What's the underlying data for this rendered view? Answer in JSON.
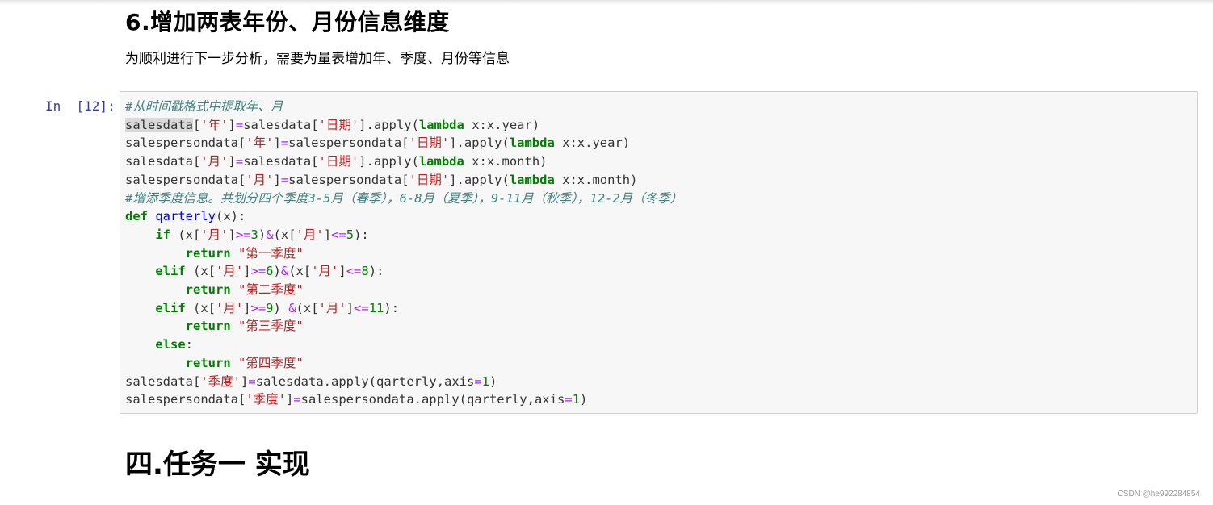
{
  "section": {
    "heading": "6.增加两表年份、月份信息维度",
    "description": "为顺利进行下一步分析，需要为量表增加年、季度、月份等信息"
  },
  "cell": {
    "prompt": "In  [12]:",
    "lines": [
      [
        {
          "t": "#从时间戳格式中提取年、月",
          "c": "cm"
        }
      ],
      [
        {
          "t": "salesdata",
          "c": "hl"
        },
        {
          "t": "["
        },
        {
          "t": "'年'",
          "c": "st"
        },
        {
          "t": "]"
        },
        {
          "t": "=",
          "c": "op"
        },
        {
          "t": "salesdata["
        },
        {
          "t": "'日期'",
          "c": "st"
        },
        {
          "t": "].apply("
        },
        {
          "t": "lambda",
          "c": "kw"
        },
        {
          "t": " x:x.year)"
        }
      ],
      [
        {
          "t": "salespersondata["
        },
        {
          "t": "'年'",
          "c": "st"
        },
        {
          "t": "]"
        },
        {
          "t": "=",
          "c": "op"
        },
        {
          "t": "salespersondata["
        },
        {
          "t": "'日期'",
          "c": "st"
        },
        {
          "t": "].apply("
        },
        {
          "t": "lambda",
          "c": "kw"
        },
        {
          "t": " x:x.year)"
        }
      ],
      [
        {
          "t": "salesdata["
        },
        {
          "t": "'月'",
          "c": "st"
        },
        {
          "t": "]"
        },
        {
          "t": "=",
          "c": "op"
        },
        {
          "t": "salesdata["
        },
        {
          "t": "'日期'",
          "c": "st"
        },
        {
          "t": "].apply("
        },
        {
          "t": "lambda",
          "c": "kw"
        },
        {
          "t": " x:x.month)"
        }
      ],
      [
        {
          "t": "salespersondata["
        },
        {
          "t": "'月'",
          "c": "st"
        },
        {
          "t": "]"
        },
        {
          "t": "=",
          "c": "op"
        },
        {
          "t": "salespersondata["
        },
        {
          "t": "'日期'",
          "c": "st"
        },
        {
          "t": "].apply("
        },
        {
          "t": "lambda",
          "c": "kw"
        },
        {
          "t": " x:x.month)"
        }
      ],
      [
        {
          "t": "#增添季度信息。共划分四个季度3-5月（春季），6-8月（夏季），9-11月（秋季），12-2月（冬季）",
          "c": "cm"
        }
      ],
      [
        {
          "t": "def",
          "c": "kw"
        },
        {
          "t": " "
        },
        {
          "t": "qarterly",
          "c": "fn"
        },
        {
          "t": "(x):"
        }
      ],
      [
        {
          "t": "    "
        },
        {
          "t": "if",
          "c": "kw"
        },
        {
          "t": " (x["
        },
        {
          "t": "'月'",
          "c": "st"
        },
        {
          "t": "]"
        },
        {
          "t": ">=",
          "c": "op"
        },
        {
          "t": "3",
          "c": "nm"
        },
        {
          "t": ")"
        },
        {
          "t": "&",
          "c": "op"
        },
        {
          "t": "(x["
        },
        {
          "t": "'月'",
          "c": "st"
        },
        {
          "t": "]"
        },
        {
          "t": "<=",
          "c": "op"
        },
        {
          "t": "5",
          "c": "nm"
        },
        {
          "t": "):"
        }
      ],
      [
        {
          "t": "        "
        },
        {
          "t": "return",
          "c": "kw"
        },
        {
          "t": " "
        },
        {
          "t": "\"第一季度\"",
          "c": "st"
        }
      ],
      [
        {
          "t": "    "
        },
        {
          "t": "elif",
          "c": "kw"
        },
        {
          "t": " (x["
        },
        {
          "t": "'月'",
          "c": "st"
        },
        {
          "t": "]"
        },
        {
          "t": ">=",
          "c": "op"
        },
        {
          "t": "6",
          "c": "nm"
        },
        {
          "t": ")"
        },
        {
          "t": "&",
          "c": "op"
        },
        {
          "t": "(x["
        },
        {
          "t": "'月'",
          "c": "st"
        },
        {
          "t": "]"
        },
        {
          "t": "<=",
          "c": "op"
        },
        {
          "t": "8",
          "c": "nm"
        },
        {
          "t": "):"
        }
      ],
      [
        {
          "t": "        "
        },
        {
          "t": "return",
          "c": "kw"
        },
        {
          "t": " "
        },
        {
          "t": "\"第二季度\"",
          "c": "st"
        }
      ],
      [
        {
          "t": "    "
        },
        {
          "t": "elif",
          "c": "kw"
        },
        {
          "t": " (x["
        },
        {
          "t": "'月'",
          "c": "st"
        },
        {
          "t": "]"
        },
        {
          "t": ">=",
          "c": "op"
        },
        {
          "t": "9",
          "c": "nm"
        },
        {
          "t": ") "
        },
        {
          "t": "&",
          "c": "op"
        },
        {
          "t": "(x["
        },
        {
          "t": "'月'",
          "c": "st"
        },
        {
          "t": "]"
        },
        {
          "t": "<=",
          "c": "op"
        },
        {
          "t": "11",
          "c": "nm"
        },
        {
          "t": "):"
        }
      ],
      [
        {
          "t": "        "
        },
        {
          "t": "return",
          "c": "kw"
        },
        {
          "t": " "
        },
        {
          "t": "\"第三季度\"",
          "c": "st"
        }
      ],
      [
        {
          "t": "    "
        },
        {
          "t": "else",
          "c": "kw"
        },
        {
          "t": ":"
        }
      ],
      [
        {
          "t": "        "
        },
        {
          "t": "return",
          "c": "kw"
        },
        {
          "t": " "
        },
        {
          "t": "\"第四季度\"",
          "c": "st"
        }
      ],
      [
        {
          "t": "salesdata["
        },
        {
          "t": "'季度'",
          "c": "st"
        },
        {
          "t": "]"
        },
        {
          "t": "=",
          "c": "op"
        },
        {
          "t": "salesdata.apply(qarterly,axis"
        },
        {
          "t": "=",
          "c": "op"
        },
        {
          "t": "1",
          "c": "nm"
        },
        {
          "t": ")"
        }
      ],
      [
        {
          "t": "salespersondata["
        },
        {
          "t": "'季度'",
          "c": "st"
        },
        {
          "t": "]"
        },
        {
          "t": "=",
          "c": "op"
        },
        {
          "t": "salespersondata.apply(qarterly,axis"
        },
        {
          "t": "=",
          "c": "op"
        },
        {
          "t": "1",
          "c": "nm"
        },
        {
          "t": ")"
        }
      ]
    ]
  },
  "next_section": {
    "heading": "四.任务一 实现"
  },
  "watermark": "CSDN @he992284854"
}
